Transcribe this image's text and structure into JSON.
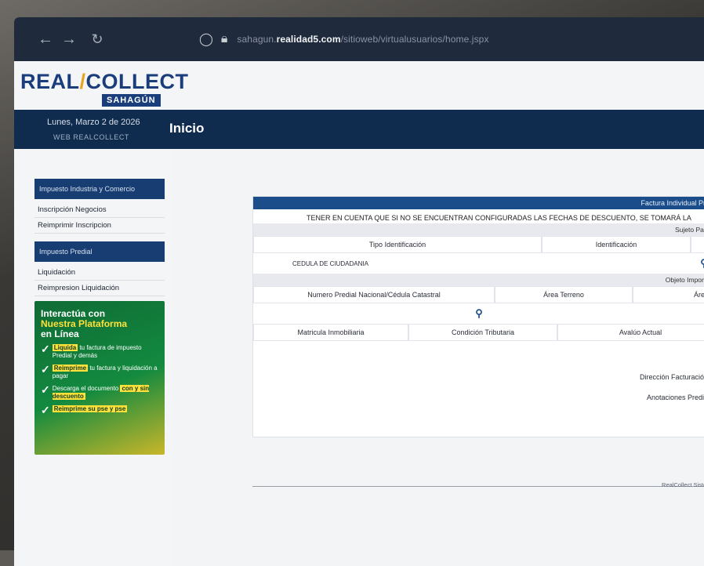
{
  "browser": {
    "url_prefix": "sahagun.",
    "url_host": "realidad5.com",
    "url_path": "/sitioweb/virtualusuarios/home.jspx"
  },
  "header": {
    "logo_main": "REAL",
    "logo_slash": "/",
    "logo_rest": "COLLECT",
    "logo_sub": "SAHAGÚN",
    "date": "Lunes, Marzo 2 de 2026",
    "web_label": "WEB REALCOLLECT",
    "page_title": "Inicio"
  },
  "sidebar": {
    "section1_title": "Impuesto Industria y Comercio",
    "section1_items": [
      "Inscripción Negocios",
      "Reimprimir Inscripcion"
    ],
    "section2_title": "Impuesto Predial",
    "section2_items": [
      "Liquidación",
      "Reimpresion Liquidación"
    ]
  },
  "promo": {
    "title_1": "Interactúa con",
    "title_2": "Nuestra Plataforma",
    "title_3": "en Línea",
    "items": [
      {
        "tag": "Liquida",
        "text": "tu factura de impuesto Predial y demás"
      },
      {
        "tag": "Reimprime",
        "text": "tu factura y liquidación a pagar"
      },
      {
        "tag": "",
        "text": "Descarga el documento",
        "tag2": "con y sin descuento"
      },
      {
        "tag": "Reimprime su pse y pse",
        "text": ""
      }
    ]
  },
  "form": {
    "panel_title": "Factura Individual Predio",
    "notice": "TENER EN CUENTA QUE SI NO SE ENCUENTRAN CONFIGURADAS LAS FECHAS DE DESCUENTO, SE TOMARÁ LA",
    "sujeto_label": "Sujeto Pasivo",
    "tipo_id_label": "Tipo Identificación",
    "identificacion_label": "Identificación",
    "tipo_id_value": "CEDULA DE CIUDADANIA",
    "objeto_label": "Objeto Imponible",
    "numero_predial_label": "Numero Predial Nacional/Cédula Catastral",
    "area_terreno_label": "Área Terreno",
    "area_co_label": "Área Co",
    "matricula_label": "Matricula Inmobiliaria",
    "condicion_label": "Condición Tributaria",
    "avaluo_label": "Avalúo Actual",
    "direccion_label": "Dirección Facturación",
    "anotaciones_label": "Anotaciones Predio",
    "footer_text": "RealCollect Sistema de"
  }
}
